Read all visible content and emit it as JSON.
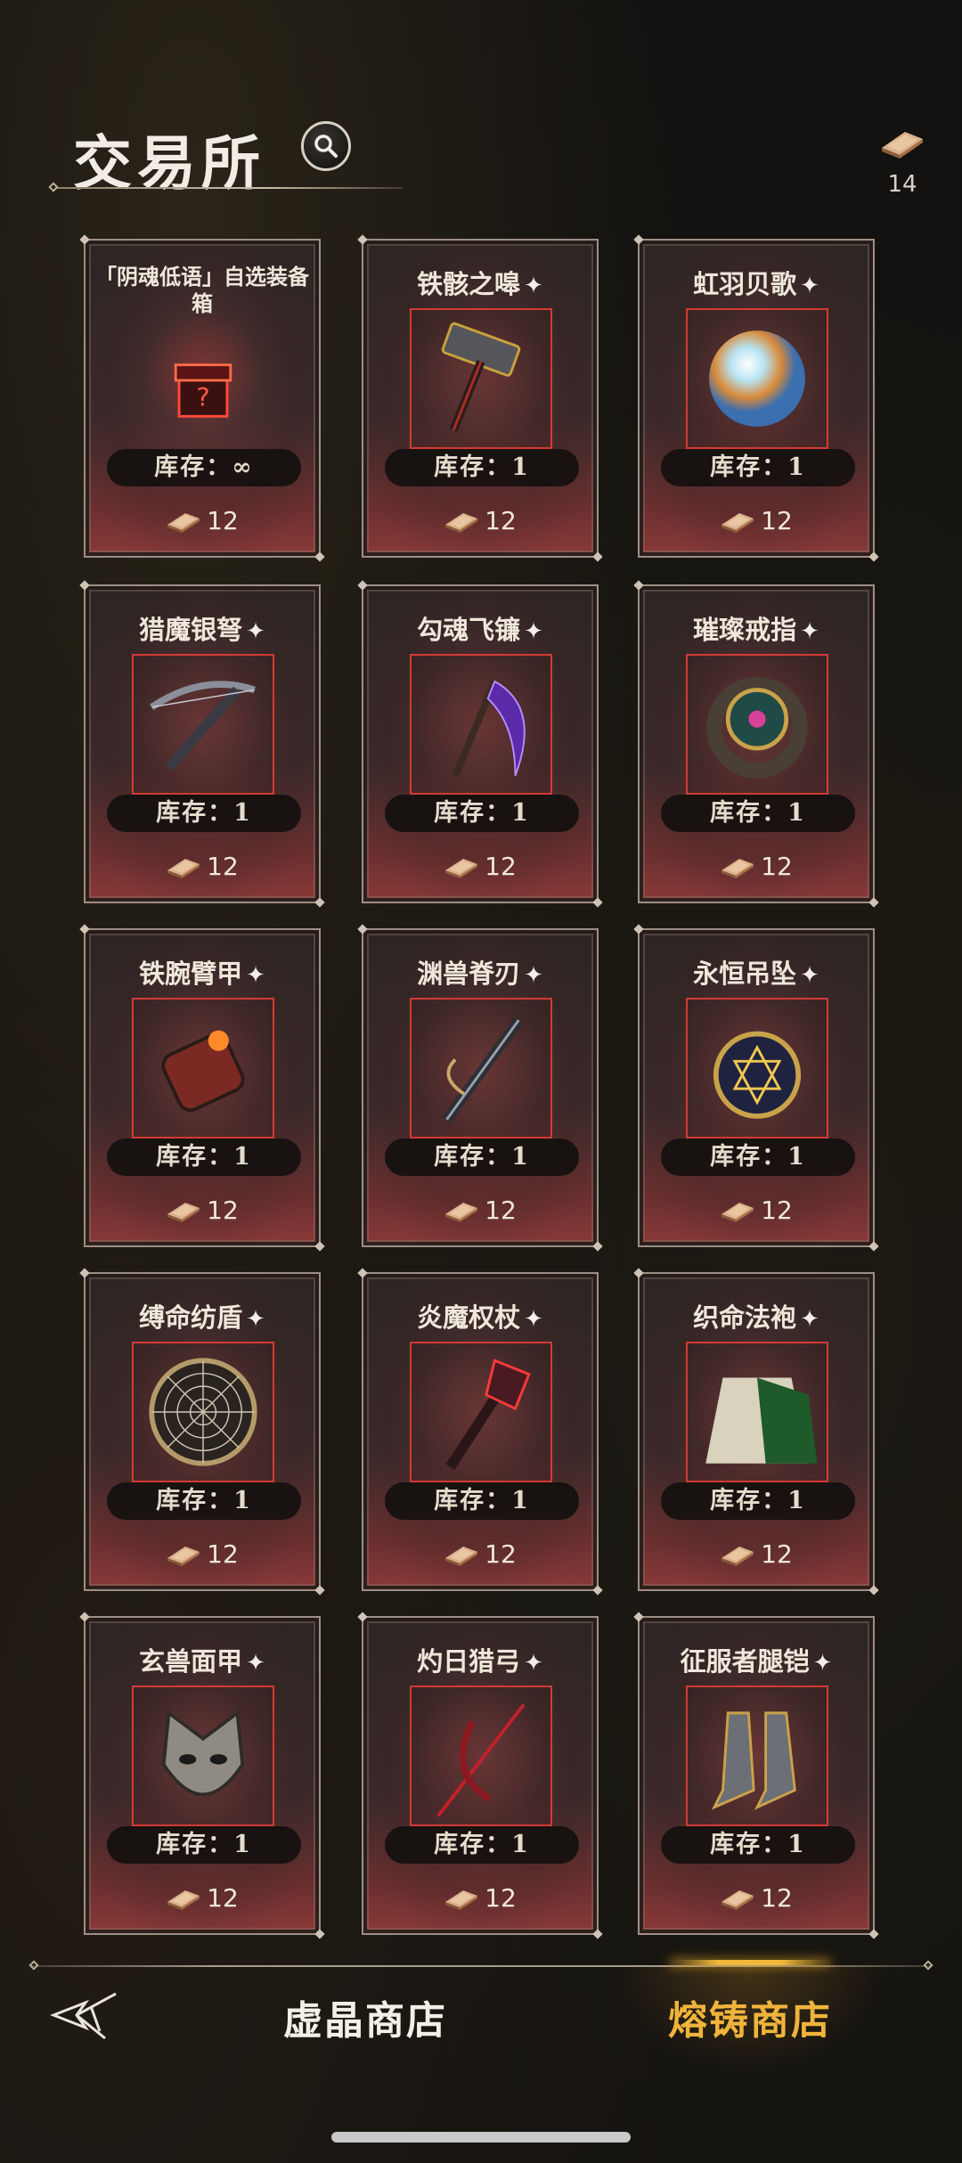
{
  "header": {
    "title": "交易所",
    "currency_count": "14"
  },
  "items": [
    {
      "name": "「阴魂低语」自选装备箱",
      "stock": "库存：∞",
      "price": "12",
      "icon": "chest-icon",
      "starred": false
    },
    {
      "name": "铁骸之嗥",
      "stock": "库存：1",
      "price": "12",
      "icon": "hammer-icon",
      "starred": true
    },
    {
      "name": "虹羽贝歌",
      "stock": "库存：1",
      "price": "12",
      "icon": "orb-icon",
      "starred": true
    },
    {
      "name": "猎魔银弩",
      "stock": "库存：1",
      "price": "12",
      "icon": "crossbow-icon",
      "starred": true
    },
    {
      "name": "勾魂飞镰",
      "stock": "库存：1",
      "price": "12",
      "icon": "scythe-icon",
      "starred": true
    },
    {
      "name": "璀璨戒指",
      "stock": "库存：1",
      "price": "12",
      "icon": "ring-icon",
      "starred": true
    },
    {
      "name": "铁腕臂甲",
      "stock": "库存：1",
      "price": "12",
      "icon": "bracer-icon",
      "starred": true
    },
    {
      "name": "渊兽脊刃",
      "stock": "库存：1",
      "price": "12",
      "icon": "blade-icon",
      "starred": true
    },
    {
      "name": "永恒吊坠",
      "stock": "库存：1",
      "price": "12",
      "icon": "pendant-icon",
      "starred": true
    },
    {
      "name": "缚命纺盾",
      "stock": "库存：1",
      "price": "12",
      "icon": "shield-icon",
      "starred": true
    },
    {
      "name": "炎魔权杖",
      "stock": "库存：1",
      "price": "12",
      "icon": "scepter-icon",
      "starred": true
    },
    {
      "name": "织命法袍",
      "stock": "库存：1",
      "price": "12",
      "icon": "robe-icon",
      "starred": true
    },
    {
      "name": "玄兽面甲",
      "stock": "库存：1",
      "price": "12",
      "icon": "mask-icon",
      "starred": true
    },
    {
      "name": "灼日猎弓",
      "stock": "库存：1",
      "price": "12",
      "icon": "bow-icon",
      "starred": true
    },
    {
      "name": "征服者腿铠",
      "stock": "库存：1",
      "price": "12",
      "icon": "greaves-icon",
      "starred": true
    }
  ],
  "star_glyph": "✦",
  "nav": {
    "tab_crystal": "虚晶商店",
    "tab_forge": "熔铸商店",
    "active": "tab_forge"
  },
  "colors": {
    "accent_gold": "#f0b43c",
    "frame_red": "#d33a35"
  }
}
